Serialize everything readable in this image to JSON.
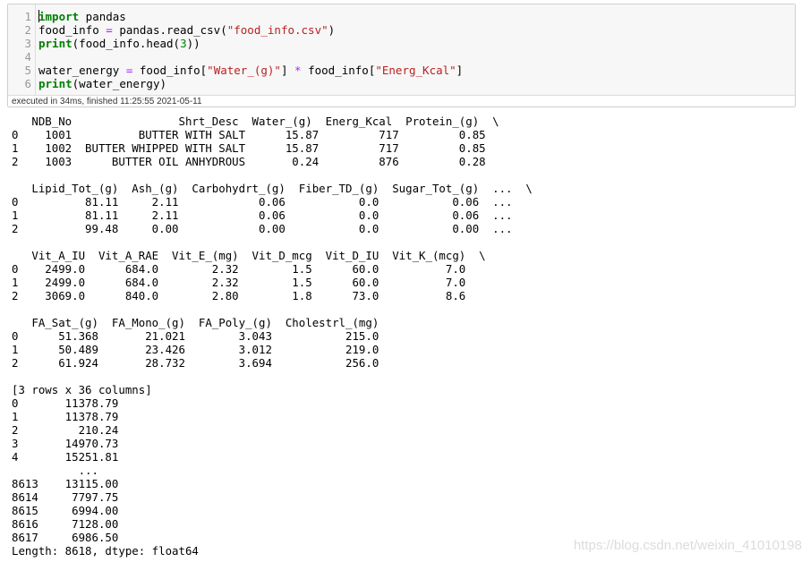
{
  "code_cell": {
    "line_numbers": [
      "1",
      "2",
      "3",
      "4",
      "5",
      "6"
    ],
    "line1": {
      "kw": "import",
      "rest": " pandas"
    },
    "line2": {
      "a": "food_info ",
      "op": "=",
      "b": " pandas.read_csv(",
      "str": "\"food_info.csv\"",
      "c": ")"
    },
    "line3": {
      "kw": "print",
      "a": "(food_info.head(",
      "num": "3",
      "b": "))"
    },
    "line5": {
      "a": "water_energy ",
      "op1": "=",
      "b": " food_info[",
      "str1": "\"Water_(g)\"",
      "c": "] ",
      "op2": "*",
      "d": " food_info[",
      "str2": "\"Energ_Kcal\"",
      "e": "]"
    },
    "line6": {
      "kw": "print",
      "a": "(water_energy)"
    },
    "status": "executed in 34ms, finished 11:25:55 2021-05-11"
  },
  "output_lines": [
    "   NDB_No                Shrt_Desc  Water_(g)  Energ_Kcal  Protein_(g)  \\",
    "0    1001          BUTTER WITH SALT      15.87         717         0.85",
    "1    1002  BUTTER WHIPPED WITH SALT      15.87         717         0.85",
    "2    1003      BUTTER OIL ANHYDROUS       0.24         876         0.28",
    "",
    "   Lipid_Tot_(g)  Ash_(g)  Carbohydrt_(g)  Fiber_TD_(g)  Sugar_Tot_(g)  ...  \\",
    "0          81.11     2.11            0.06           0.0           0.06  ...",
    "1          81.11     2.11            0.06           0.0           0.06  ...",
    "2          99.48     0.00            0.00           0.0           0.00  ...",
    "",
    "   Vit_A_IU  Vit_A_RAE  Vit_E_(mg)  Vit_D_mcg  Vit_D_IU  Vit_K_(mcg)  \\",
    "0    2499.0      684.0        2.32        1.5      60.0          7.0",
    "1    2499.0      684.0        2.32        1.5      60.0          7.0",
    "2    3069.0      840.0        2.80        1.8      73.0          8.6",
    "",
    "   FA_Sat_(g)  FA_Mono_(g)  FA_Poly_(g)  Cholestrl_(mg)",
    "0      51.368       21.021        3.043           215.0",
    "1      50.489       23.426        3.012           219.0",
    "2      61.924       28.732        3.694           256.0",
    "",
    "[3 rows x 36 columns]",
    "0       11378.79",
    "1       11378.79",
    "2         210.24",
    "3       14970.73",
    "4       15251.81",
    "          ...",
    "8613    13115.00",
    "8614     7797.75",
    "8615     6994.00",
    "8616     7128.00",
    "8617     6986.50",
    "Length: 8618, dtype: float64"
  ],
  "watermark": "https://blog.csdn.net/weixin_41010198"
}
